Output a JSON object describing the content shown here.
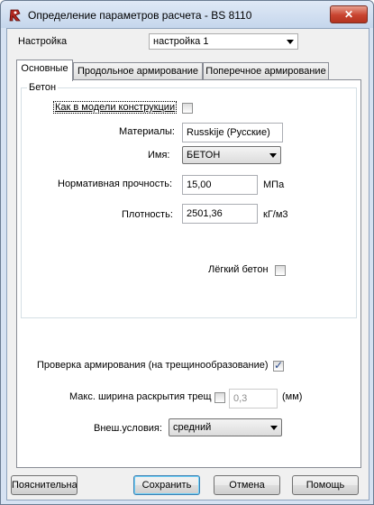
{
  "window": {
    "title": "Определение параметров расчета - BS 8110",
    "close_glyph": "✕"
  },
  "settings": {
    "label": "Настройка",
    "value": "настройка 1"
  },
  "tabs": [
    {
      "label": "Основные"
    },
    {
      "label": "Продольное армирование"
    },
    {
      "label": "Поперечное армирование"
    }
  ],
  "concrete": {
    "group_label": "Бетон",
    "as_in_model_label": "Как в модели конструкции",
    "as_in_model_checked": false,
    "materials_label": "Материалы:",
    "materials_value": "Russkije (Русские)",
    "name_label": "Имя:",
    "name_value": "БЕТОН",
    "strength_label": "Нормативная прочность:",
    "strength_value": "15,00",
    "strength_unit": "МПа",
    "density_label": "Плотность:",
    "density_value": "2501,36",
    "density_unit": "кГ/м3",
    "light_label": "Лёгкий бетон",
    "light_checked": false
  },
  "crack_check": {
    "label": "Проверка армирования (на трещинообразование)",
    "checked": true
  },
  "max_width": {
    "label": "Макс. ширина раскрытия трещ",
    "checked": false,
    "value": "0,3",
    "unit": "(мм)"
  },
  "env": {
    "label": "Внеш.условия:",
    "value": "средний"
  },
  "buttons": {
    "notes": "Пояснительная записка",
    "save": "Сохранить",
    "cancel": "Отмена",
    "help": "Помощь"
  }
}
